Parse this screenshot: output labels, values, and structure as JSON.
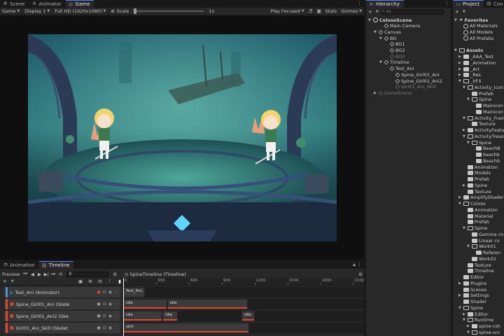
{
  "left_tabs": [
    {
      "label": "Scene",
      "icon": "hash-icon",
      "active": false
    },
    {
      "label": "Animator",
      "icon": "animator-icon",
      "active": false
    },
    {
      "label": "Game",
      "icon": "gamepad-icon",
      "active": true
    }
  ],
  "game_toolbar": {
    "view": "Game",
    "display": "Display 1",
    "resolution": "Full HD (1920x1080)",
    "scale_label": "Scale",
    "scale_value": "1x",
    "play_mode": "Play Focused",
    "stats": "Stats",
    "gizmos": "Gizmos"
  },
  "timeline": {
    "tabs": [
      {
        "label": "Animation",
        "active": false
      },
      {
        "label": "Timeline",
        "active": true
      }
    ],
    "preview_label": "Preview",
    "frame_value": "0",
    "asset_name": "SpineTimeline (Timeline)",
    "add_label": "+",
    "ruler_ticks": [
      "0",
      "300",
      "600",
      "900",
      "1200",
      "1500",
      "1800",
      "2100"
    ],
    "tracks": [
      {
        "name": "Test_Ani (Animator)",
        "color": "#4f8fd6",
        "clips": [
          {
            "label": "Test_Ani...",
            "start": 0,
            "end": 200
          }
        ]
      },
      {
        "name": "Spine_Girl01_Ani (Skele",
        "color": "#e0472f",
        "clips": [
          {
            "label": "idle",
            "start": 0,
            "end": 400
          },
          {
            "label": "idle",
            "start": 400,
            "end": 1140
          }
        ]
      },
      {
        "name": "Spine_Girl01_Ani2 (Ske",
        "color": "#e0472f",
        "clips": [
          {
            "label": "idle",
            "start": 0,
            "end": 360
          },
          {
            "label": "idle",
            "start": 360,
            "end": 500
          },
          {
            "label": "idle",
            "start": 1080,
            "end": 1200
          }
        ]
      },
      {
        "name": "Girl01_Ani_Skill (Skelet",
        "color": "#e0472f",
        "clips": [
          {
            "label": "skill",
            "start": 0,
            "end": 1150
          }
        ]
      }
    ]
  },
  "hierarchy": {
    "tab_label": "Hierarchy",
    "search_placeholder": "All",
    "items": [
      {
        "label": "ColosoScene",
        "depth": 0,
        "icon": "unity",
        "arrow": "▼",
        "dim": false
      },
      {
        "label": "Main Camera",
        "depth": 2,
        "icon": "cube",
        "arrow": "",
        "dim": false
      },
      {
        "label": "Canvas",
        "depth": 1,
        "icon": "cube",
        "arrow": "▼",
        "dim": false
      },
      {
        "label": "BG",
        "depth": 2,
        "icon": "cube",
        "arrow": "▼",
        "dim": false
      },
      {
        "label": "BG1",
        "depth": 3,
        "icon": "cube",
        "arrow": "",
        "dim": false
      },
      {
        "label": "BG2",
        "depth": 3,
        "icon": "cube",
        "arrow": "",
        "dim": false
      },
      {
        "label": "BG3",
        "depth": 3,
        "icon": "cube",
        "arrow": "",
        "dim": true
      },
      {
        "label": "Timeline",
        "depth": 2,
        "icon": "cube",
        "arrow": "▼",
        "dim": false
      },
      {
        "label": "Test_Ani",
        "depth": 3,
        "icon": "cube",
        "arrow": "",
        "dim": false
      },
      {
        "label": "Spine_Girl01_Ani",
        "depth": 4,
        "icon": "cube",
        "arrow": "",
        "dim": false
      },
      {
        "label": "Spine_Girl01_Ani2",
        "depth": 4,
        "icon": "cube",
        "arrow": "",
        "dim": false
      },
      {
        "label": "Girl01_Ani_Skill",
        "depth": 4,
        "icon": "cube",
        "arrow": "",
        "dim": true
      },
      {
        "label": "GameScene",
        "depth": 1,
        "icon": "cube",
        "arrow": "▶",
        "dim": true
      }
    ]
  },
  "project": {
    "tabs": [
      {
        "label": "Project",
        "active": true
      },
      {
        "label": "Con",
        "active": false
      }
    ],
    "items": [
      {
        "label": "Favorites",
        "depth": 0,
        "arrow": "▼",
        "kind": "star"
      },
      {
        "label": "All Materials",
        "depth": 1,
        "arrow": "",
        "kind": "search"
      },
      {
        "label": "All Models",
        "depth": 1,
        "arrow": "",
        "kind": "search"
      },
      {
        "label": "All Prefabs",
        "depth": 1,
        "arrow": "",
        "kind": "search"
      },
      {
        "label": "",
        "depth": 0,
        "arrow": "",
        "kind": "gap"
      },
      {
        "label": "Assets",
        "depth": 0,
        "arrow": "▼",
        "kind": "folder"
      },
      {
        "label": "_AAA_Test",
        "depth": 1,
        "arrow": "▶",
        "kind": "folder"
      },
      {
        "label": "_Animation",
        "depth": 1,
        "arrow": "▶",
        "kind": "folder"
      },
      {
        "label": "_Art",
        "depth": 1,
        "arrow": "▶",
        "kind": "folder"
      },
      {
        "label": "_Res",
        "depth": 1,
        "arrow": "▶",
        "kind": "folder"
      },
      {
        "label": "_VFX",
        "depth": 1,
        "arrow": "▼",
        "kind": "folder"
      },
      {
        "label": "Activity_Icon",
        "depth": 2,
        "arrow": "▼",
        "kind": "folder"
      },
      {
        "label": "Prefab",
        "depth": 3,
        "arrow": "",
        "kind": "folder"
      },
      {
        "label": "Spine",
        "depth": 3,
        "arrow": "▼",
        "kind": "folder"
      },
      {
        "label": "Mainicon",
        "depth": 4,
        "arrow": "",
        "kind": "folder"
      },
      {
        "label": "Mainicon",
        "depth": 4,
        "arrow": "",
        "kind": "folder"
      },
      {
        "label": "Activity_Frame",
        "depth": 2,
        "arrow": "▼",
        "kind": "folder"
      },
      {
        "label": "Texture",
        "depth": 3,
        "arrow": "",
        "kind": "folder"
      },
      {
        "label": "ActivityFeature",
        "depth": 2,
        "arrow": "▶",
        "kind": "folder"
      },
      {
        "label": "ActivityTreasure",
        "depth": 2,
        "arrow": "▼",
        "kind": "folder"
      },
      {
        "label": "Spine",
        "depth": 3,
        "arrow": "▼",
        "kind": "folder"
      },
      {
        "label": "BeachB",
        "depth": 4,
        "arrow": "",
        "kind": "folder"
      },
      {
        "label": "beachb",
        "depth": 4,
        "arrow": "",
        "kind": "folder"
      },
      {
        "label": "Beachb",
        "depth": 4,
        "arrow": "",
        "kind": "folder"
      },
      {
        "label": "Animation",
        "depth": 2,
        "arrow": "",
        "kind": "folder"
      },
      {
        "label": "Models",
        "depth": 2,
        "arrow": "",
        "kind": "folder"
      },
      {
        "label": "Prefab",
        "depth": 2,
        "arrow": "",
        "kind": "folder"
      },
      {
        "label": "Spine",
        "depth": 2,
        "arrow": "▶",
        "kind": "folder"
      },
      {
        "label": "Texture",
        "depth": 2,
        "arrow": "",
        "kind": "folder"
      },
      {
        "label": "AmplifyShaderEditor",
        "depth": 1,
        "arrow": "▶",
        "kind": "folder"
      },
      {
        "label": "Coloso",
        "depth": 1,
        "arrow": "▼",
        "kind": "folder"
      },
      {
        "label": "Animation",
        "depth": 2,
        "arrow": "",
        "kind": "folder"
      },
      {
        "label": "Material",
        "depth": 2,
        "arrow": "",
        "kind": "folder"
      },
      {
        "label": "Prefab",
        "depth": 2,
        "arrow": "",
        "kind": "folder"
      },
      {
        "label": "Spine",
        "depth": 2,
        "arrow": "▼",
        "kind": "folder"
      },
      {
        "label": "Gamma co",
        "depth": 3,
        "arrow": "",
        "kind": "folder"
      },
      {
        "label": "Linear co",
        "depth": 3,
        "arrow": "",
        "kind": "folder"
      },
      {
        "label": "Work01",
        "depth": 3,
        "arrow": "▼",
        "kind": "folder"
      },
      {
        "label": "Referen",
        "depth": 4,
        "arrow": "",
        "kind": "folder"
      },
      {
        "label": "Work02",
        "depth": 3,
        "arrow": "",
        "kind": "folder"
      },
      {
        "label": "Texture",
        "depth": 2,
        "arrow": "",
        "kind": "folder"
      },
      {
        "label": "Timeline",
        "depth": 2,
        "arrow": "",
        "kind": "folder"
      },
      {
        "label": "Editor",
        "depth": 1,
        "arrow": "",
        "kind": "folder"
      },
      {
        "label": "Plugins",
        "depth": 1,
        "arrow": "▶",
        "kind": "folder"
      },
      {
        "label": "Scenes",
        "depth": 1,
        "arrow": "",
        "kind": "folder"
      },
      {
        "label": "Settings",
        "depth": 1,
        "arrow": "▶",
        "kind": "folder"
      },
      {
        "label": "Shader",
        "depth": 1,
        "arrow": "",
        "kind": "folder"
      },
      {
        "label": "Spine",
        "depth": 1,
        "arrow": "▼",
        "kind": "folder"
      },
      {
        "label": "Editor",
        "depth": 2,
        "arrow": "▶",
        "kind": "folder"
      },
      {
        "label": "Runtime",
        "depth": 2,
        "arrow": "▼",
        "kind": "folder"
      },
      {
        "label": "spine-csh",
        "depth": 3,
        "arrow": "▶",
        "kind": "folder"
      },
      {
        "label": "spine-uni",
        "depth": 3,
        "arrow": "▼",
        "kind": "folder"
      },
      {
        "label": "Asset T",
        "depth": 4,
        "arrow": "",
        "kind": "folder"
      }
    ]
  },
  "colors": {
    "accent": "#4c7eff",
    "clip_red": "#e0472f",
    "animator_blue": "#4f8fd6"
  }
}
